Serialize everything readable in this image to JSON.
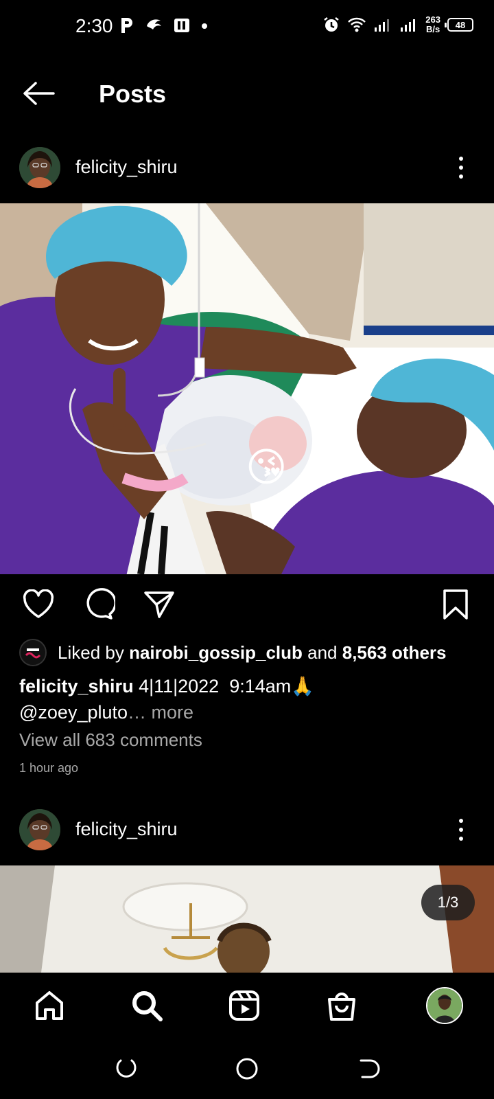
{
  "status_bar": {
    "time": "2:30",
    "net_speed_value": "263",
    "net_speed_unit": "B/s",
    "battery": "48"
  },
  "header": {
    "title": "Posts"
  },
  "post1": {
    "username": "felicity_shiru",
    "liked_prefix": "Liked by ",
    "liked_user": "nairobi_gossip_club",
    "liked_mid": " and ",
    "liked_others": "8,563 others",
    "caption_user": "felicity_shiru",
    "caption_text": " 4|11|2022  9:14am🙏",
    "caption_line2": "@zoey_pluto",
    "caption_more": "… more",
    "view_comments": "View all 683 comments",
    "time_ago": "1 hour ago",
    "sticker": "😘"
  },
  "post2": {
    "username": "felicity_shiru",
    "counter": "1/3"
  },
  "colors": {
    "background": "#000000",
    "secondary_text": "#a8a8a8",
    "scrubs": "#5b2d9e",
    "cap": "#4fb6d6"
  },
  "icons": {
    "back": "arrow-left",
    "like": "heart",
    "comment": "speech-bubble",
    "share": "paper-plane",
    "save": "bookmark",
    "home": "home",
    "search": "magnifier",
    "reels": "reels",
    "shop": "shopping-bag"
  }
}
